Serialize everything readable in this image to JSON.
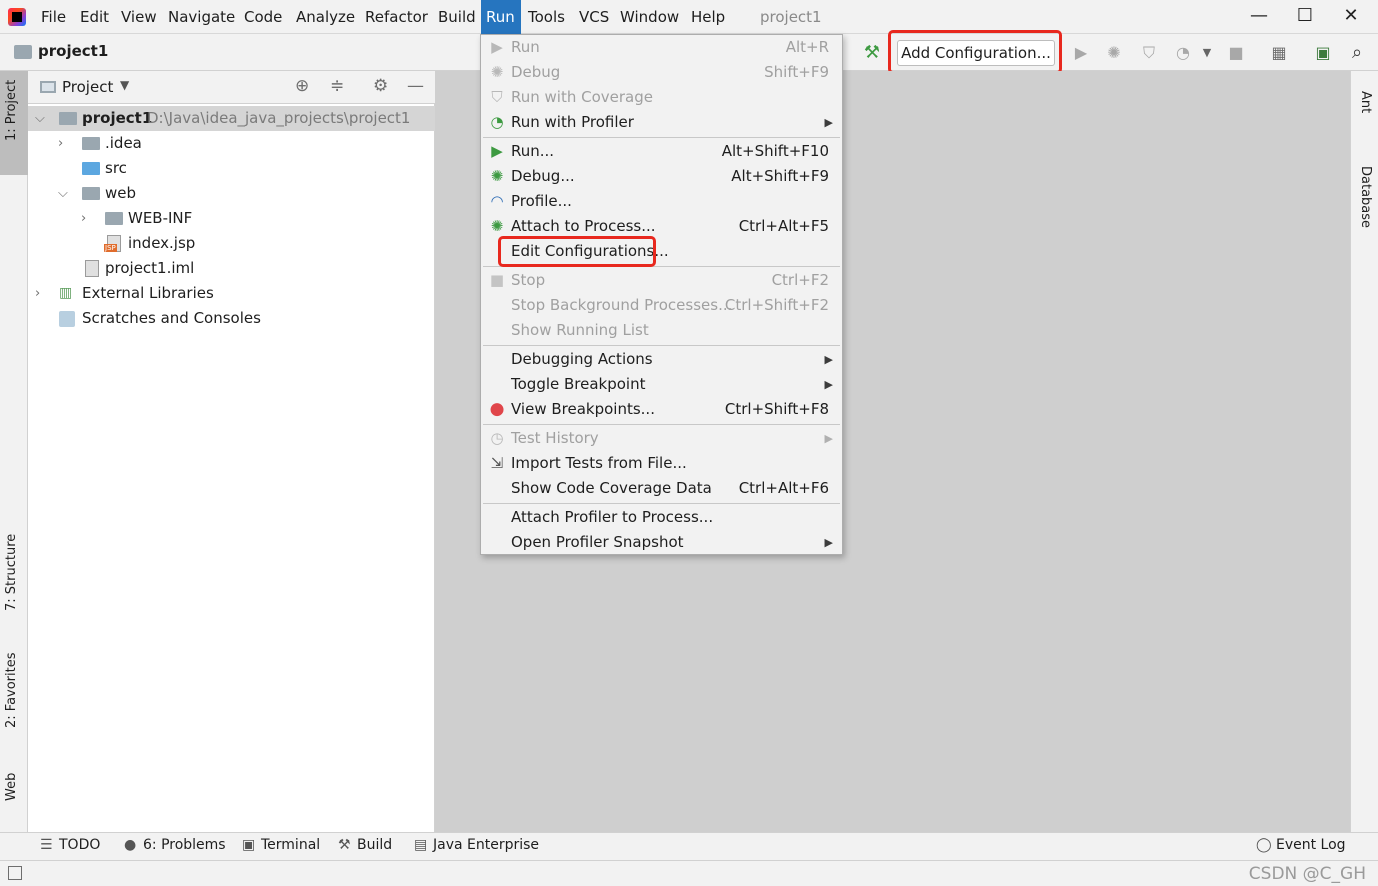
{
  "menubar": {
    "items": [
      "File",
      "Edit",
      "View",
      "Navigate",
      "Code",
      "Analyze",
      "Refactor",
      "Build",
      "Run",
      "Tools",
      "VCS",
      "Window",
      "Help"
    ],
    "active": "Run",
    "window_title": "project1",
    "window_controls": {
      "minimize": "—",
      "maximize": "☐",
      "close": "✕"
    }
  },
  "navbar": {
    "project_name": "project1",
    "add_configuration_label": "Add Configuration..."
  },
  "left_strip": {
    "tabs": [
      "1: Project",
      "7: Structure",
      "2: Favorites",
      "Web"
    ]
  },
  "right_strip": {
    "tabs": [
      "Ant",
      "Database"
    ]
  },
  "project_panel": {
    "title": "Project",
    "tree": [
      {
        "label": "project1",
        "path": "D:\\Java\\idea_java_projects\\project1"
      },
      {
        "label": ".idea"
      },
      {
        "label": "src"
      },
      {
        "label": "web"
      },
      {
        "label": "WEB-INF"
      },
      {
        "label": "index.jsp",
        "badge": "JSP"
      },
      {
        "label": "project1.iml"
      },
      {
        "label": "External Libraries"
      },
      {
        "label": "Scratches and Consoles"
      }
    ]
  },
  "run_menu": {
    "items": [
      {
        "label": "Run",
        "shortcut": "Alt+R",
        "enabled": false,
        "icon": "run-icon"
      },
      {
        "label": "Debug",
        "shortcut": "Shift+F9",
        "enabled": false,
        "icon": "debug-icon"
      },
      {
        "label": "Run with Coverage",
        "shortcut": "",
        "enabled": false,
        "icon": "coverage-icon"
      },
      {
        "label": "Run with Profiler",
        "shortcut": "",
        "enabled": true,
        "icon": "profiler-icon",
        "submenu": true
      },
      {
        "label": "Run...",
        "shortcut": "Alt+Shift+F10",
        "enabled": true,
        "icon": "run-icon"
      },
      {
        "label": "Debug...",
        "shortcut": "Alt+Shift+F9",
        "enabled": true,
        "icon": "debug-icon"
      },
      {
        "label": "Profile...",
        "shortcut": "",
        "enabled": true,
        "icon": "profile-icon"
      },
      {
        "label": "Attach to Process...",
        "shortcut": "Ctrl+Alt+F5",
        "enabled": true,
        "icon": "attach-icon"
      },
      {
        "label": "Edit Configurations...",
        "shortcut": "",
        "enabled": true,
        "icon": ""
      },
      {
        "label": "Stop",
        "shortcut": "Ctrl+F2",
        "enabled": false,
        "icon": "stop-icon"
      },
      {
        "label": "Stop Background Processes...",
        "shortcut": "Ctrl+Shift+F2",
        "enabled": false,
        "icon": ""
      },
      {
        "label": "Show Running List",
        "shortcut": "",
        "enabled": false,
        "icon": ""
      },
      {
        "label": "Debugging Actions",
        "shortcut": "",
        "enabled": true,
        "icon": "",
        "submenu": true
      },
      {
        "label": "Toggle Breakpoint",
        "shortcut": "",
        "enabled": true,
        "icon": "",
        "submenu": true
      },
      {
        "label": "View Breakpoints...",
        "shortcut": "Ctrl+Shift+F8",
        "enabled": true,
        "icon": "breakpoint-icon"
      },
      {
        "label": "Test History",
        "shortcut": "",
        "enabled": false,
        "icon": "history-icon",
        "submenu": true
      },
      {
        "label": "Import Tests from File...",
        "shortcut": "",
        "enabled": true,
        "icon": "import-icon"
      },
      {
        "label": "Show Code Coverage Data",
        "shortcut": "Ctrl+Alt+F6",
        "enabled": true,
        "icon": ""
      },
      {
        "label": "Attach Profiler to Process...",
        "shortcut": "",
        "enabled": true,
        "icon": ""
      },
      {
        "label": "Open Profiler Snapshot",
        "shortcut": "",
        "enabled": true,
        "icon": "",
        "submenu": true
      }
    ]
  },
  "bottom_bar": {
    "items": [
      "TODO",
      "6: Problems",
      "Terminal",
      "Build",
      "Java Enterprise"
    ],
    "event_log": "Event Log"
  },
  "status_bar": {
    "watermark": "CSDN @C_GH"
  },
  "colors": {
    "accent": "#2675bf",
    "highlight_box": "#e8281e",
    "editor_bg": "#cfcfcf",
    "run_green": "#3d9a41"
  }
}
